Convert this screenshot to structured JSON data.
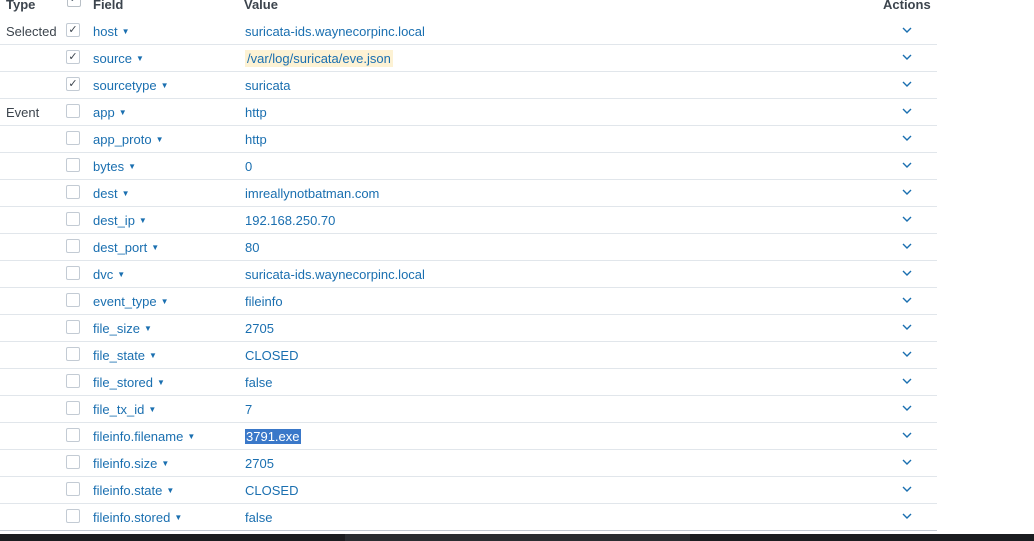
{
  "header": {
    "type": "Type",
    "field": "Field",
    "value": "Value",
    "actions": "Actions",
    "check_all_mark": "✓"
  },
  "groups": {
    "selected": "Selected",
    "event": "Event"
  },
  "check_mark": "✓",
  "caret": "▼",
  "rows": [
    {
      "field": "host",
      "value": "suricata-ids.waynecorpinc.local",
      "checked": true
    },
    {
      "field": "source",
      "value": "/var/log/suricata/eve.json",
      "checked": true
    },
    {
      "field": "sourcetype",
      "value": "suricata",
      "checked": true
    },
    {
      "field": "app",
      "value": "http",
      "checked": false
    },
    {
      "field": "app_proto",
      "value": "http",
      "checked": false
    },
    {
      "field": "bytes",
      "value": "0",
      "checked": false
    },
    {
      "field": "dest",
      "value": "imreallynotbatman.com",
      "checked": false
    },
    {
      "field": "dest_ip",
      "value": "192.168.250.70",
      "checked": false
    },
    {
      "field": "dest_port",
      "value": "80",
      "checked": false
    },
    {
      "field": "dvc",
      "value": "suricata-ids.waynecorpinc.local",
      "checked": false
    },
    {
      "field": "event_type",
      "value": "fileinfo",
      "checked": false
    },
    {
      "field": "file_size",
      "value": "2705",
      "checked": false
    },
    {
      "field": "file_state",
      "value": "CLOSED",
      "checked": false
    },
    {
      "field": "file_stored",
      "value": "false",
      "checked": false
    },
    {
      "field": "file_tx_id",
      "value": "7",
      "checked": false
    },
    {
      "field": "fileinfo.filename",
      "value": "3791.exe",
      "checked": false
    },
    {
      "field": "fileinfo.size",
      "value": "2705",
      "checked": false
    },
    {
      "field": "fileinfo.state",
      "value": "CLOSED",
      "checked": false
    },
    {
      "field": "fileinfo.stored",
      "value": "false",
      "checked": false
    }
  ],
  "colors": {
    "link": "#1a6fb0",
    "highlight_yellow": "#fdf2d4",
    "selection": "#3a78c9"
  }
}
